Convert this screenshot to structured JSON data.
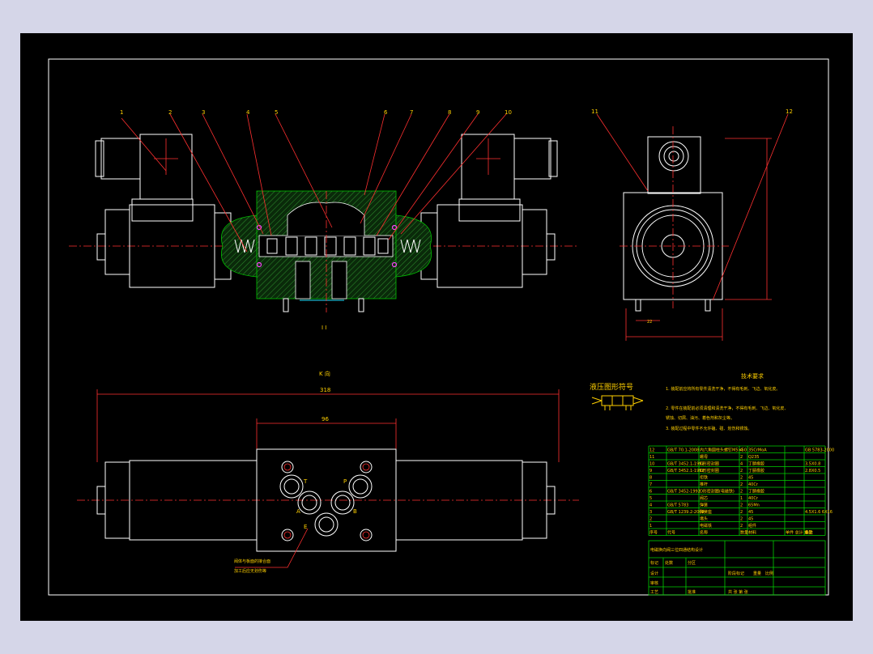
{
  "drawing": {
    "part_numbers": [
      "1",
      "2",
      "3",
      "4",
      "5",
      "6",
      "7",
      "8",
      "9",
      "10",
      "11",
      "12"
    ],
    "section_mark": "I I",
    "view_label": "K 向",
    "dim_overall": "318",
    "dim_body": "96",
    "dim_side_small": "22",
    "symbol_title": "液压图形符号",
    "port_labels": {
      "t": "T",
      "p": "P",
      "a": "A",
      "b": "B",
      "e": "E"
    },
    "port_note": [
      "阀体与板面的接合面",
      "加工后应无划伤等"
    ]
  },
  "tech_req": {
    "title": "技术要求",
    "items": [
      "1. 装配前应将所有零件清洗干净，不得有毛刺、飞边、氧化皮。",
      "2. 零件在装配前必须清理和清洗干净，不得有毛刺、飞边、氧化皮、",
      "锈蚀、切屑、油污、着色剂和灰尘等。",
      "3. 装配过程中零件不允许磕、碰、划伤和锈蚀。"
    ]
  },
  "bom": {
    "rows": [
      [
        "12",
        "GB/T 70.1-2008",
        "内六角圆柱头螺钉M5×50",
        "4",
        "35CrMoA",
        "",
        "GB 5783-2000"
      ],
      [
        "11",
        "",
        "螺母",
        "2",
        "Q235",
        "",
        ""
      ],
      [
        "10",
        "GB/T 3452.1-1992",
        "O形密封圈",
        "4",
        "丁腈橡胶",
        "",
        "3.5X0.8"
      ],
      [
        "9",
        "GB/T 3452.1-1992",
        "O形密封圈",
        "2",
        "丁腈橡胶",
        "",
        "2.8X0.5"
      ],
      [
        "8",
        "",
        "衔铁",
        "2",
        "45",
        "",
        ""
      ],
      [
        "7",
        "",
        "推杆",
        "2",
        "40Cr",
        "",
        ""
      ],
      [
        "6",
        "GB/T 3452-1992",
        "O形密封圈(电磁铁)",
        "2",
        "丁腈橡胶",
        "",
        ""
      ],
      [
        "5",
        "",
        "阀芯",
        "1",
        "40Cr",
        "",
        ""
      ],
      [
        "4",
        "GB/T 5783",
        "弹簧",
        "2",
        "65Mn",
        "",
        ""
      ],
      [
        "3",
        "GB/T 1239.2-2009",
        "弹簧座",
        "2",
        "45",
        "",
        "4.5X1.6 6X16"
      ],
      [
        "2",
        "",
        "堵头",
        "2",
        "45",
        "",
        ""
      ],
      [
        "1",
        "",
        "电磁铁",
        "2",
        "组件",
        "",
        ""
      ]
    ],
    "headers": [
      "序号",
      "代号",
      "名称",
      "数量",
      "材料",
      "单件 总计 重量",
      "备注"
    ],
    "title_block": {
      "drawing_title": "电磁换向阀三位四通结构设计",
      "labels": [
        "标记",
        "处数",
        "分区",
        "更改文件号",
        "签名",
        "年月日"
      ],
      "design": "设计",
      "review": "审核",
      "process": "工艺",
      "approve": "批准",
      "stage": "阶段标记",
      "weight": "重量",
      "scale": "比例",
      "sheet": "共 张 第 张"
    }
  },
  "colors": {
    "background": "#000000",
    "outline": "#ffffff",
    "leader": "#ff3030",
    "frame_green": "#00d000",
    "text": "#ffd000"
  }
}
